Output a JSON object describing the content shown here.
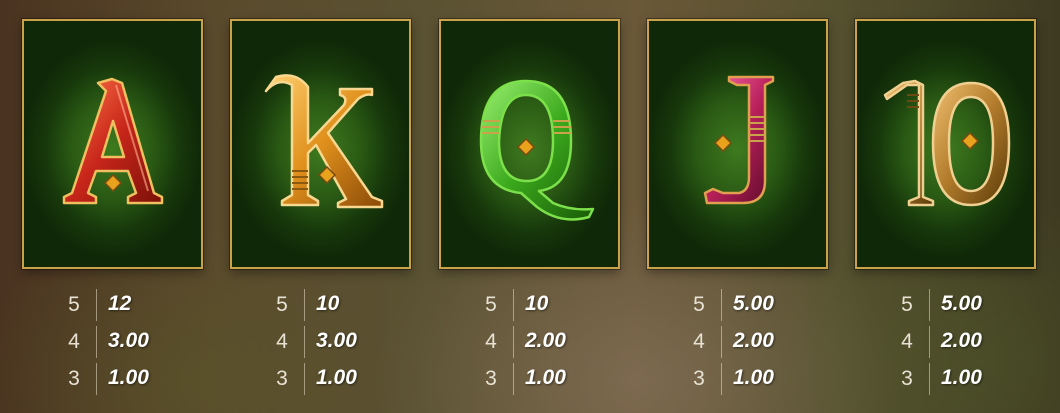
{
  "symbols": [
    {
      "letter": "A",
      "icon": "letter-a-symbol",
      "accent": "#d23a1e",
      "payouts": [
        {
          "count": "5",
          "value": "12"
        },
        {
          "count": "4",
          "value": "3.00"
        },
        {
          "count": "3",
          "value": "1.00"
        }
      ]
    },
    {
      "letter": "K",
      "icon": "letter-k-symbol",
      "accent": "#e0941c",
      "payouts": [
        {
          "count": "5",
          "value": "10"
        },
        {
          "count": "4",
          "value": "3.00"
        },
        {
          "count": "3",
          "value": "1.00"
        }
      ]
    },
    {
      "letter": "Q",
      "icon": "letter-q-symbol",
      "accent": "#3fa81c",
      "payouts": [
        {
          "count": "5",
          "value": "10"
        },
        {
          "count": "4",
          "value": "2.00"
        },
        {
          "count": "3",
          "value": "1.00"
        }
      ]
    },
    {
      "letter": "J",
      "icon": "letter-j-symbol",
      "accent": "#b8205a",
      "payouts": [
        {
          "count": "5",
          "value": "5.00"
        },
        {
          "count": "4",
          "value": "2.00"
        },
        {
          "count": "3",
          "value": "1.00"
        }
      ]
    },
    {
      "letter": "10",
      "icon": "number-10-symbol",
      "accent": "#b07a2a",
      "payouts": [
        {
          "count": "5",
          "value": "5.00"
        },
        {
          "count": "4",
          "value": "2.00"
        },
        {
          "count": "3",
          "value": "1.00"
        }
      ]
    }
  ],
  "colors": {
    "card_border": "#c9a24a",
    "card_felt": "#2a5a14",
    "gem": "#e8a21c"
  }
}
